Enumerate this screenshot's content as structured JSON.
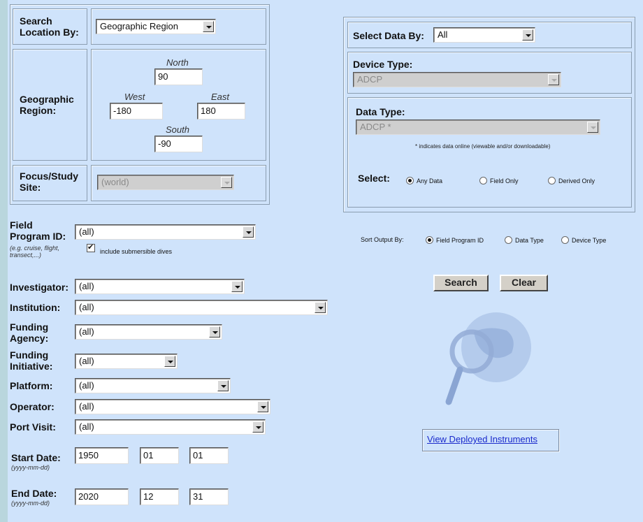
{
  "location": {
    "search_label": "Search Location By:",
    "search_value": "Geographic Region",
    "region_label": "Geographic Region:",
    "north_label": "North",
    "north_value": "90",
    "west_label": "West",
    "west_value": "-180",
    "east_label": "East",
    "east_value": "180",
    "south_label": "South",
    "south_value": "-90",
    "focus_label": "Focus/Study Site:",
    "focus_value": "(world)"
  },
  "data_select": {
    "select_by_label": "Select Data By:",
    "select_by_value": "All",
    "device_type_label": "Device Type:",
    "device_type_value": "ADCP",
    "data_type_label": "Data Type:",
    "data_type_value": "ADCP  *",
    "note": "* indicates data online (viewable and/or downloadable)",
    "select_label": "Select:",
    "radio_any": "Any Data",
    "radio_field": "Field Only",
    "radio_derived": "Derived Only"
  },
  "form": {
    "field_program_label": "Field Program ID:",
    "field_program_hint": "(e.g. cruise, flight, transect,...)",
    "field_program_value": "(all)",
    "submersible_label": "include submersible dives",
    "investigator_label": "Investigator:",
    "investigator_value": "(all)",
    "institution_label": "Institution:",
    "institution_value": "(all)",
    "funding_agency_label": "Funding Agency:",
    "funding_agency_value": "(all)",
    "funding_initiative_label": "Funding Initiative:",
    "funding_initiative_value": "(all)",
    "platform_label": "Platform:",
    "platform_value": "(all)",
    "operator_label": "Operator:",
    "operator_value": "(all)",
    "port_visit_label": "Port Visit:",
    "port_visit_value": "(all)",
    "start_date_label": "Start Date:",
    "date_hint": "(yyyy-mm-dd)",
    "start_year": "1950",
    "start_month": "01",
    "start_day": "01",
    "end_date_label": "End Date:",
    "end_year": "2020",
    "end_month": "12",
    "end_day": "31"
  },
  "sort": {
    "label": "Sort Output By:",
    "opt_program": "Field Program ID",
    "opt_data_type": "Data Type",
    "opt_device_type": "Device Type"
  },
  "actions": {
    "search": "Search",
    "clear": "Clear",
    "deployed_link": "View Deployed Instruments"
  },
  "icons": {
    "illustration": "magnifier-globe-icon"
  }
}
